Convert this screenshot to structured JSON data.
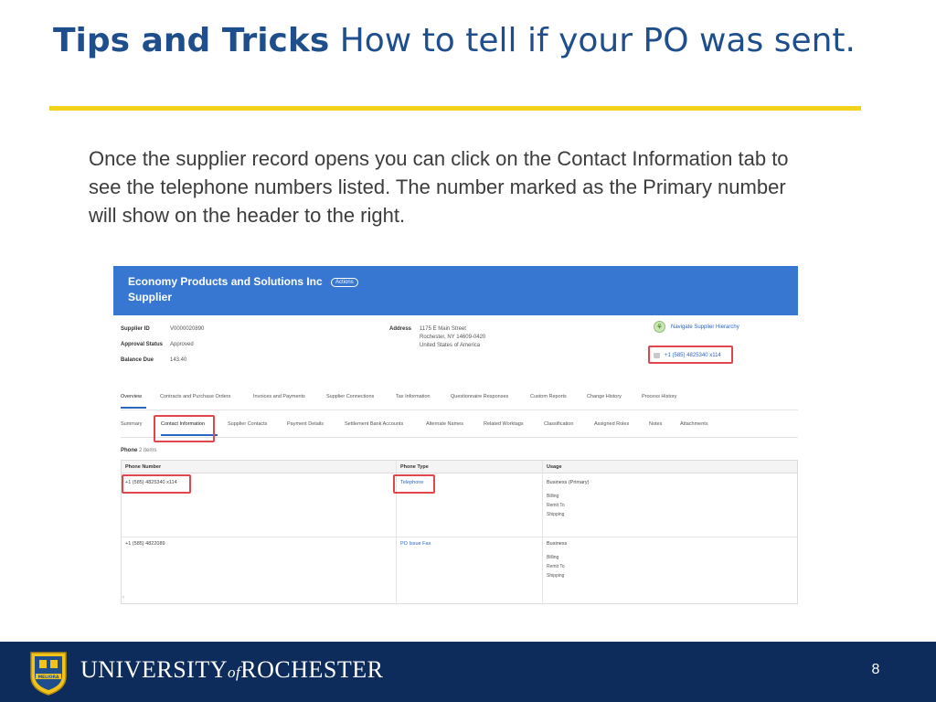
{
  "slide": {
    "title_strong": "Tips and Tricks",
    "title_rest": " How to tell if your PO was sent.",
    "intro": "Once the supplier record opens you can click on the Contact Information tab to see the telephone numbers listed.  The number marked as the Primary number will show on the header to the right.",
    "page_number": "8"
  },
  "footer": {
    "university_a": "UNIVERSITY",
    "university_of": "of",
    "university_b": "ROCHESTER",
    "seal_text": "MELIORA"
  },
  "colors": {
    "title": "#1f4e8c",
    "rule": "#f2d21b",
    "header_blue": "#3877d1",
    "footer_navy": "#0d2c5c",
    "highlight_red": "#e0474c",
    "link_blue": "#2b66c2"
  },
  "screenshot": {
    "supplier_name": "Economy Products and Solutions Inc",
    "actions_label": "Actions",
    "record_type": "Supplier",
    "fields": {
      "supplier_id_label": "Supplier ID",
      "supplier_id_value": "V0000020890",
      "approval_status_label": "Approval Status",
      "approval_status_value": "Approved",
      "balance_due_label": "Balance Due",
      "balance_due_value": "143.40",
      "address_label": "Address",
      "address_line1": "1175 E Main Street",
      "address_line2": "Rochester, NY 14609-0420",
      "address_line3": "United States of America"
    },
    "navigate_hierarchy_label": "Navigate Supplier Hierarchy",
    "header_phone": "+1 (585) 4825340 x114",
    "main_tabs": [
      "Overview",
      "Contracts and Purchase Orders",
      "Invoices and Payments",
      "Supplier Connections",
      "Tax Information",
      "Questionnaire Responses",
      "Custom Reports",
      "Change History",
      "Process History"
    ],
    "sub_tabs": [
      "Summary",
      "Contact Information",
      "Supplier Contacts",
      "Payment Details",
      "Settlement Bank Accounts",
      "Alternate Names",
      "Related Worktags",
      "Classification",
      "Assigned Roles",
      "Notes",
      "Attachments"
    ],
    "phone_section": {
      "label": "Phone",
      "count": "2 items",
      "columns": [
        "Phone Number",
        "Phone Type",
        "Usage"
      ],
      "rows": [
        {
          "number": "+1 (585) 4825340 x114",
          "type": "Telephone",
          "usage_primary": "Business (Primary)",
          "usage_lines": [
            "Billing",
            "Remit To",
            "Shipping"
          ]
        },
        {
          "number": "+1 (585) 4822089",
          "type": "PO Issue Fax",
          "usage_primary": "Business",
          "usage_lines": [
            "Billing",
            "Remit To",
            "Shipping"
          ]
        }
      ]
    }
  }
}
